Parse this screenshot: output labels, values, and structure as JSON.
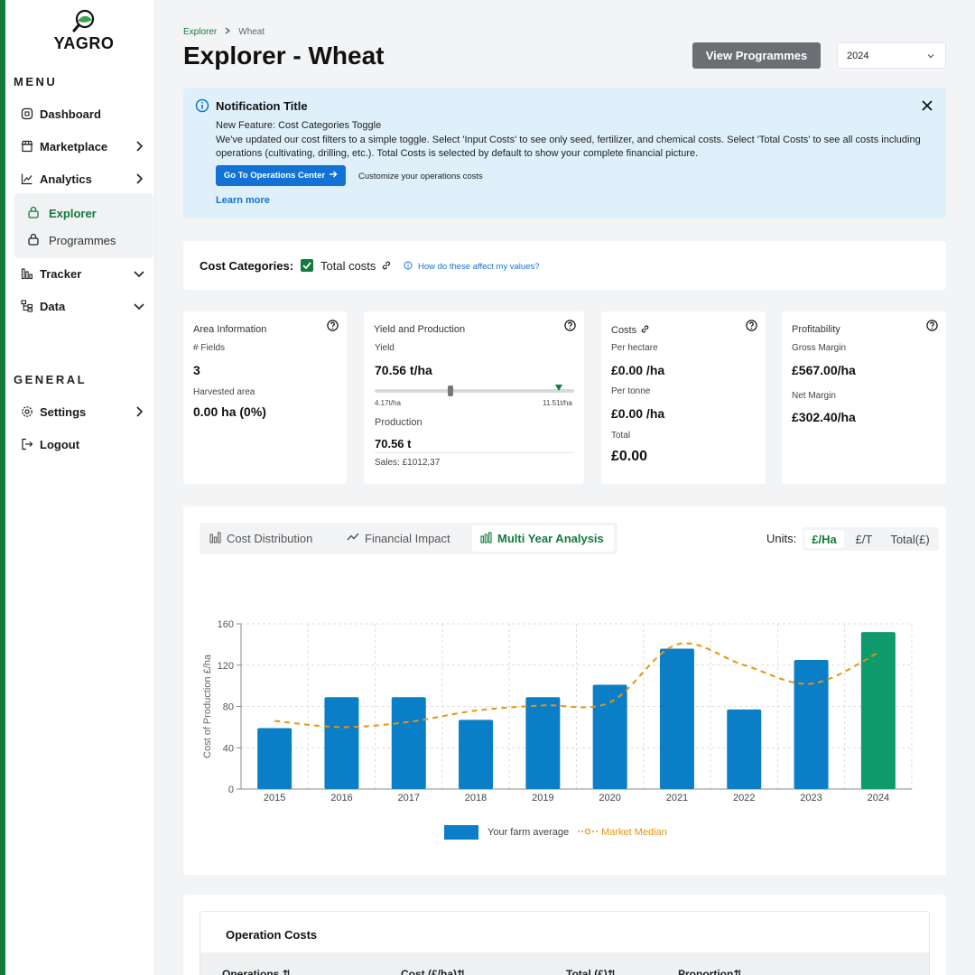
{
  "brand": {
    "name": "YAGRO"
  },
  "sidebar": {
    "menu_label": "MENU",
    "general_label": "GENERAL",
    "items": [
      {
        "label": "Dashboard",
        "icon": "dashboard-icon"
      },
      {
        "label": "Marketplace",
        "icon": "marketplace-icon"
      },
      {
        "label": "Analytics",
        "icon": "analytics-icon"
      },
      {
        "label": "Explorer",
        "icon": "lock-icon",
        "active": true
      },
      {
        "label": "Programmes",
        "icon": "lock-icon"
      },
      {
        "label": "Tracker",
        "icon": "bar-chart-icon"
      },
      {
        "label": "Data",
        "icon": "data-icon"
      },
      {
        "label": "Settings",
        "icon": "gear-icon"
      },
      {
        "label": "Logout",
        "icon": "logout-icon"
      }
    ]
  },
  "breadcrumb": {
    "root": "Explorer",
    "current": "Wheat"
  },
  "header": {
    "title": "Explorer - Wheat",
    "view_programmes": "View Programmes",
    "year": "2024"
  },
  "notification": {
    "title": "Notification Title",
    "subtitle": "New Feature: Cost Categories Toggle",
    "body": "We've updated our cost filters to a simple toggle. Select 'Input Costs' to see only seed, fertilizer, and chemical costs. Select 'Total Costs' to see all costs including operations (cultivating, drilling, etc.). Total Costs is selected by default to show your complete financial picture.",
    "button": "Go To Operations Center",
    "customize": "Customize your operations costs",
    "learn_more": "Learn more"
  },
  "cost_categories": {
    "label": "Cost Categories:",
    "option": "Total costs",
    "checked": true,
    "help": "How do these affect my values?"
  },
  "area": {
    "heading": "Area Information",
    "fields_label": "# Fields",
    "fields_value": "3",
    "harvested_label": "Harvested area",
    "harvested_value": "0.00 ha (0%)"
  },
  "yield": {
    "heading": "Yield and Production",
    "yield_label": "Yield",
    "yield_value": "70.56 t/ha",
    "min": "4.17t/ha",
    "max": "11.51t/ha",
    "production_label": "Production",
    "production_value": "70.56 t",
    "sales": "Sales: £1012,37"
  },
  "costs": {
    "heading": "Costs",
    "per_hectare_label": "Per hectare",
    "per_hectare_value": "£0.00 /ha",
    "per_tonne_label": "Per tonne",
    "per_tonne_value": "£0.00 /ha",
    "total_label": "Total",
    "total_value": "£0.00"
  },
  "profitability": {
    "heading": "Profitability",
    "gross_label": "Gross Margin",
    "gross_value": "£567.00/ha",
    "net_label": "Net Margin",
    "net_value": "£302.40/ha"
  },
  "tabs": [
    "Cost Distribution",
    "Financial Impact",
    "Multi Year Analysis"
  ],
  "units": {
    "label": "Units:",
    "options": [
      "£/Ha",
      "£/T",
      "Total(£)"
    ],
    "selected": "£/Ha"
  },
  "chart_data": {
    "type": "bar",
    "categories": [
      "2015",
      "2016",
      "2017",
      "2018",
      "2019",
      "2020",
      "2021",
      "2022",
      "2023",
      "2024"
    ],
    "series": [
      {
        "name": "Your farm average",
        "values": [
          59,
          89,
          89,
          67,
          89,
          101,
          136,
          77,
          125,
          152
        ],
        "color": "#0a7fc7",
        "highlight_last": "#0e9a6a"
      },
      {
        "name": "Market Median",
        "values": [
          66,
          60,
          65,
          76,
          81,
          84,
          140,
          120,
          102,
          132
        ],
        "color": "#e8940f",
        "style": "dashed-line"
      }
    ],
    "xlabel": "",
    "ylabel": "Cost of Production £/ha",
    "ylim": [
      0,
      160
    ],
    "yticks": [
      0,
      40,
      80,
      120,
      160
    ],
    "grid": true,
    "legend_position": "bottom"
  },
  "operations": {
    "title": "Operation Costs",
    "columns": [
      "Operations",
      "Cost (£/ha)",
      "Total (£)",
      "Proportion"
    ]
  }
}
